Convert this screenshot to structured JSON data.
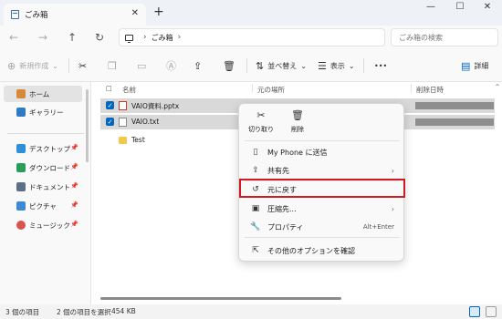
{
  "window": {
    "tab_title": "ごみ箱",
    "tab_close": "✕",
    "new_tab": "+",
    "controls": {
      "minimize": "—",
      "maximize": "☐",
      "close": "✕"
    }
  },
  "nav": {
    "back": "←",
    "forward": "→",
    "up": "↑",
    "refresh": "↻",
    "breadcrumb": [
      "ごみ箱"
    ],
    "breadcrumb_sep": "›",
    "search_placeholder": "ごみ箱の検索"
  },
  "command_bar": {
    "new_label": "新規作成",
    "sort_label": "並べ替え",
    "view_label": "表示",
    "more_label": "•••",
    "details_label": "詳細"
  },
  "sidebar": {
    "primary": [
      {
        "label": "ホーム",
        "icon": "home-icon",
        "color": "#d8883a",
        "active": true
      },
      {
        "label": "ギャラリー",
        "icon": "gallery-icon",
        "color": "#2f7bc4",
        "active": false
      }
    ],
    "pinned": [
      {
        "label": "デスクトップ",
        "icon": "desktop-icon",
        "color": "#2f8fd8"
      },
      {
        "label": "ダウンロード",
        "icon": "download-icon",
        "color": "#2a9d5c"
      },
      {
        "label": "ドキュメント",
        "icon": "documents-icon",
        "color": "#5b6f85"
      },
      {
        "label": "ピクチャ",
        "icon": "pictures-icon",
        "color": "#3a8ad6"
      },
      {
        "label": "ミュージック",
        "icon": "music-icon",
        "color": "#d9534f"
      }
    ],
    "pin_glyph": "📌"
  },
  "file_list": {
    "columns": {
      "name": "名前",
      "original_location": "元の場所",
      "date_deleted": "削除日時"
    },
    "rows": [
      {
        "name": "VAIO資料.pptx",
        "type": "pptx",
        "selected": true
      },
      {
        "name": "VAIO.txt",
        "type": "txt",
        "selected": true
      },
      {
        "name": "Test",
        "type": "folder",
        "selected": false
      }
    ],
    "sort_indicator": "^"
  },
  "status_bar": {
    "item_count": "3 個の項目",
    "selection": "2 個の項目を選択",
    "size": "454 KB"
  },
  "context_menu": {
    "quick_actions": [
      {
        "label": "切り取り",
        "icon": "cut-icon"
      },
      {
        "label": "削除",
        "icon": "trash-icon"
      }
    ],
    "items": [
      {
        "label": "My Phone に送信",
        "icon": "phone-icon",
        "has_submenu": false,
        "shortcut": ""
      },
      {
        "label": "共有先",
        "icon": "share-icon",
        "has_submenu": true,
        "shortcut": ""
      },
      {
        "label": "元に戻す",
        "icon": "restore-icon",
        "has_submenu": false,
        "shortcut": "",
        "highlighted": true
      },
      {
        "label": "圧縮先...",
        "icon": "compress-icon",
        "has_submenu": true,
        "shortcut": ""
      },
      {
        "label": "プロパティ",
        "icon": "properties-icon",
        "has_submenu": false,
        "shortcut": "Alt+Enter"
      },
      {
        "label": "その他のオプションを確認",
        "icon": "more-options-icon",
        "has_submenu": false,
        "shortcut": ""
      }
    ],
    "submenu_arrow": "›"
  },
  "colors": {
    "accent": "#0067c0",
    "highlight_box": "#d11a22",
    "selected_row": "#d9d9d9",
    "redaction": "#8e8e8e"
  }
}
